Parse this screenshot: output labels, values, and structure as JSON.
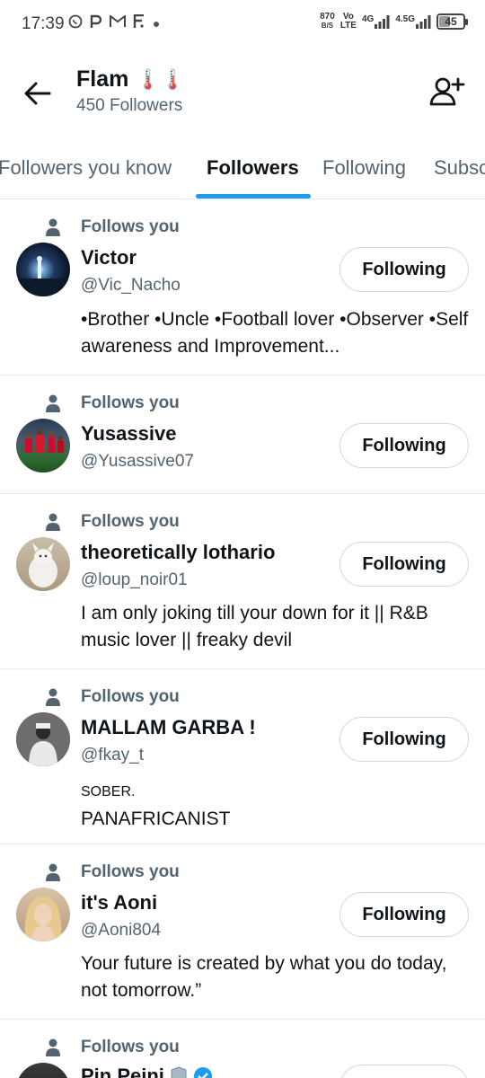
{
  "status_bar": {
    "time": "17:39",
    "speed_value": "870",
    "speed_unit": "B/S",
    "volte_top": "Vo",
    "volte_bottom": "LTE",
    "net1": "4G",
    "net2": "4.5G",
    "battery": "45",
    "battery_level": 0.45
  },
  "header": {
    "title": "Flam",
    "title_emoji": "🌡️🌡️",
    "subtitle": "450 Followers"
  },
  "tabs": [
    {
      "label": "Followers you know"
    },
    {
      "label": "Followers"
    },
    {
      "label": "Following"
    },
    {
      "label": "Subsc"
    }
  ],
  "follows_you_label": "Follows you",
  "following_label": "Following",
  "users": [
    {
      "name": "Victor",
      "handle": "@Vic_Nacho",
      "bio": "•Brother •Uncle •Football lover •Observer •Self awareness and Improvement..."
    },
    {
      "name": "Yusassive",
      "handle": "@Yusassive07",
      "bio": ""
    },
    {
      "name": "theoretically lothario",
      "handle": "@loup_noir01",
      "bio": "I am only joking till your down for it || R&B music lover || freaky devil"
    },
    {
      "name": "MALLAM GARBA !",
      "handle": "@fkay_t",
      "bio_line1": "SOBER.",
      "bio_line2": "PANAFRICANIST"
    },
    {
      "name": "it's Aoni",
      "handle": "@Aoni804",
      "bio": "Your future is created by what you do today, not tomorrow.”"
    },
    {
      "name": "Pin Peini",
      "handle": "",
      "bio": ""
    }
  ],
  "colors": {
    "accent": "#1d9bf0",
    "secondary_text": "#536471",
    "primary_text": "#0f1419",
    "divider": "#e6ecf0"
  }
}
